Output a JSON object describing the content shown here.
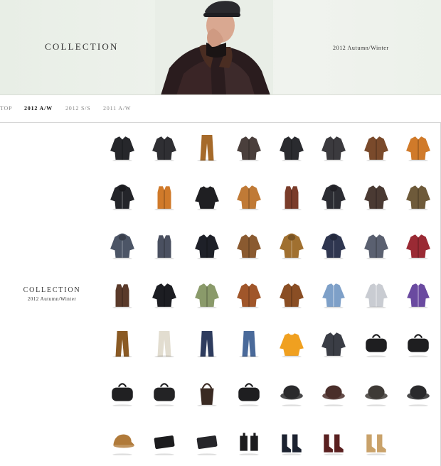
{
  "hero": {
    "title": "COLLECTION",
    "season": "2012 Autumn/Winter"
  },
  "subnav": {
    "items": [
      {
        "label": "TOP",
        "active": false
      },
      {
        "label": "2012 A/W",
        "active": true
      },
      {
        "label": "2012 S/S",
        "active": false
      },
      {
        "label": "2011 A/W",
        "active": false
      }
    ]
  },
  "collection": {
    "title": "COLLECTION",
    "season": "2012 Autumn/Winter",
    "items": [
      {
        "kind": "jacket",
        "color": "#26272b"
      },
      {
        "kind": "jacket",
        "color": "#2f2f33"
      },
      {
        "kind": "pants",
        "color": "#a66a2a"
      },
      {
        "kind": "jacket",
        "color": "#4a3f3c"
      },
      {
        "kind": "jacket",
        "color": "#2a2b2f"
      },
      {
        "kind": "jacket",
        "color": "#3b3a3e"
      },
      {
        "kind": "jacket",
        "color": "#7a4a2b"
      },
      {
        "kind": "jacket",
        "color": "#d07a2a"
      },
      {
        "kind": "hoodie",
        "color": "#24252a"
      },
      {
        "kind": "vest",
        "color": "#d07a2a"
      },
      {
        "kind": "sweater",
        "color": "#1f1f22"
      },
      {
        "kind": "jacket",
        "color": "#c07a36"
      },
      {
        "kind": "vest",
        "color": "#7a3c2a"
      },
      {
        "kind": "hoodie",
        "color": "#2c2d33"
      },
      {
        "kind": "jacket",
        "color": "#4a3a33"
      },
      {
        "kind": "jacket",
        "color": "#6e5a3a"
      },
      {
        "kind": "hoodie",
        "color": "#4c5566"
      },
      {
        "kind": "vest",
        "color": "#4a5060"
      },
      {
        "kind": "jacket",
        "color": "#1e2028"
      },
      {
        "kind": "jacket",
        "color": "#8a5a30"
      },
      {
        "kind": "hoodie",
        "color": "#a07030"
      },
      {
        "kind": "hoodie",
        "color": "#2f3650"
      },
      {
        "kind": "jacket",
        "color": "#5a6070"
      },
      {
        "kind": "jacket",
        "color": "#9a2a34"
      },
      {
        "kind": "vest",
        "color": "#5a3a2a"
      },
      {
        "kind": "jacket",
        "color": "#1c1d22"
      },
      {
        "kind": "jacket",
        "color": "#8a9a6a"
      },
      {
        "kind": "jacket",
        "color": "#a0562a"
      },
      {
        "kind": "jacket",
        "color": "#8a4e24"
      },
      {
        "kind": "shirt",
        "color": "#7ea0c8"
      },
      {
        "kind": "shirt",
        "color": "#c9ccd2"
      },
      {
        "kind": "shirt",
        "color": "#6a4aa0"
      },
      {
        "kind": "pants",
        "color": "#8a5a24"
      },
      {
        "kind": "pants",
        "color": "#e2ddd0"
      },
      {
        "kind": "pants",
        "color": "#2e3c5e"
      },
      {
        "kind": "pants",
        "color": "#4a6a9a"
      },
      {
        "kind": "sweater",
        "color": "#f0a020"
      },
      {
        "kind": "jacket",
        "color": "#3a3d45"
      },
      {
        "kind": "bag",
        "color": "#1e1e20"
      },
      {
        "kind": "bag",
        "color": "#1e1e20"
      },
      {
        "kind": "bag",
        "color": "#202022"
      },
      {
        "kind": "bag",
        "color": "#232325"
      },
      {
        "kind": "tote",
        "color": "#3a2a22"
      },
      {
        "kind": "bag",
        "color": "#1e1e20"
      },
      {
        "kind": "hat",
        "color": "#2a2a2c"
      },
      {
        "kind": "hat",
        "color": "#4a2e2a"
      },
      {
        "kind": "hat",
        "color": "#3e3a36"
      },
      {
        "kind": "hat",
        "color": "#2a2a2c"
      },
      {
        "kind": "cap",
        "color": "#b07a3a"
      },
      {
        "kind": "wallet",
        "color": "#1c1c1e"
      },
      {
        "kind": "wallet",
        "color": "#26262a"
      },
      {
        "kind": "gloves",
        "color": "#1c1c1e"
      },
      {
        "kind": "boots",
        "color": "#1c2230"
      },
      {
        "kind": "boots",
        "color": "#5a2020"
      },
      {
        "kind": "boots",
        "color": "#c9a26a"
      },
      {
        "kind": "empty",
        "color": "#ffffff"
      }
    ]
  }
}
